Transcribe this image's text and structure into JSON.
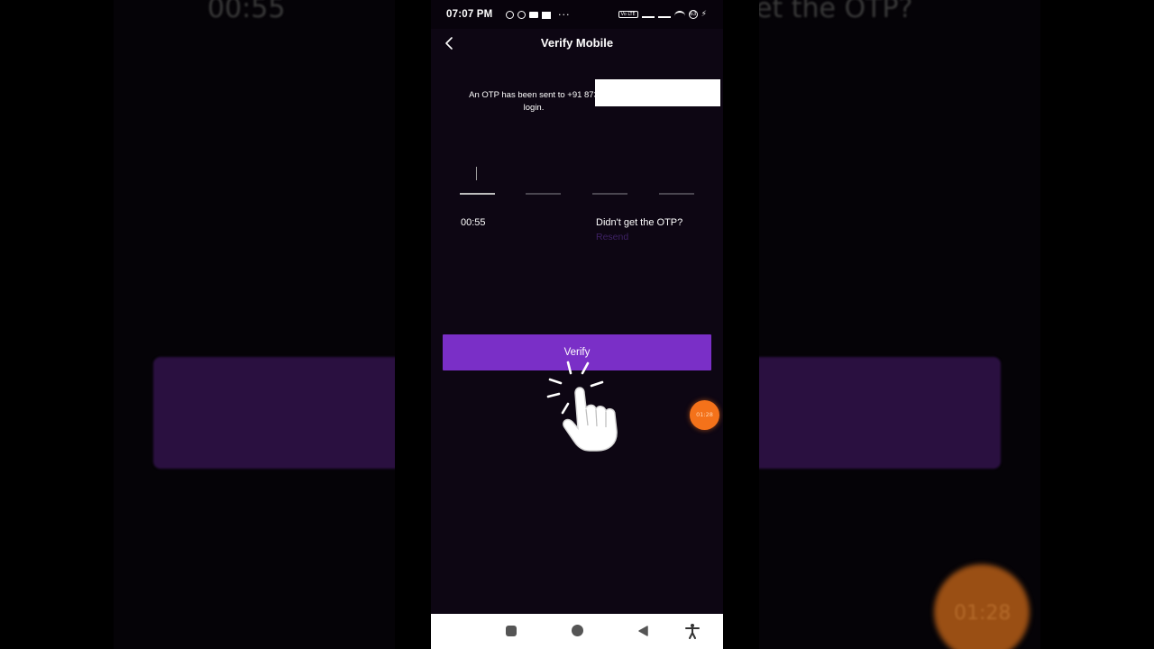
{
  "background": {
    "left_text": "00:55",
    "right_text": "et the OTP?",
    "orange_text": "01:28"
  },
  "status_bar": {
    "time": "07:07 PM",
    "overflow": "···",
    "volte": "Vo LTE",
    "battery": "63"
  },
  "header": {
    "title": "Verify Mobile",
    "back_icon": "chevron-left-icon"
  },
  "otp": {
    "message": "An OTP has been sent to +91 873 login.",
    "message_line1": "An OTP has been sent to +91 873",
    "message_line2": "login.",
    "digits": [
      "",
      "",
      "",
      ""
    ],
    "timer": "00:55",
    "didnt_get": "Didn't get the OTP?",
    "resend": "Resend"
  },
  "verify_button": {
    "label": "Verify"
  },
  "floating_timer": {
    "label": "01:28"
  },
  "colors": {
    "accent": "#7a2fc7",
    "background": "#0d0613",
    "resend_disabled": "#3e2165",
    "floating": "#f4721a"
  }
}
